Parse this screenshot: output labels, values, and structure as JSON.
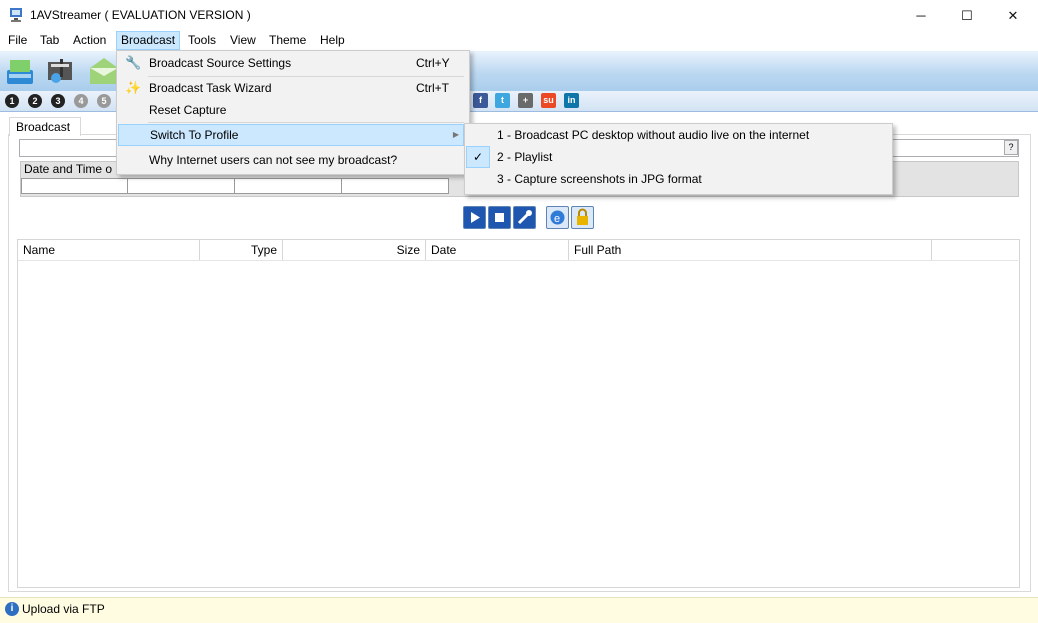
{
  "window": {
    "title": "1AVStreamer ( EVALUATION VERSION )",
    "minimize": "─",
    "maximize": "☐",
    "close": "✕"
  },
  "menubar": {
    "items": [
      "File",
      "Tab",
      "Action",
      "Broadcast",
      "Tools",
      "View",
      "Theme",
      "Help"
    ],
    "active": "Broadcast"
  },
  "profiles": [
    "1",
    "2",
    "3",
    "4",
    "5"
  ],
  "social": [
    "f",
    "t",
    "+",
    "su",
    "in"
  ],
  "tab": {
    "label": "Broadcast",
    "help": "?"
  },
  "schedule": {
    "header": "Date and Time o"
  },
  "filelist": {
    "columns": [
      "Name",
      "Type",
      "Size",
      "Date",
      "Full Path"
    ]
  },
  "status": {
    "text": "Upload via FTP"
  },
  "broadcast_menu": {
    "items": [
      {
        "label": "Broadcast Source Settings",
        "shortcut": "Ctrl+Y"
      },
      {
        "label": "Broadcast Task Wizard",
        "shortcut": "Ctrl+T"
      },
      {
        "label": "Reset Capture",
        "shortcut": ""
      },
      {
        "label": "Switch To Profile",
        "shortcut": ""
      },
      {
        "label": "Why Internet users can not see my broadcast?",
        "shortcut": ""
      }
    ]
  },
  "profile_submenu": {
    "items": [
      "1 - Broadcast PC desktop without audio live on the internet",
      "2 - Playlist",
      "3 - Capture screenshots in JPG format"
    ],
    "checked": "2 - Playlist"
  },
  "colors": {
    "menu_highlight": "#cce8ff",
    "status_bar": "#fffce2",
    "toolbar": "#bcd8f1"
  }
}
